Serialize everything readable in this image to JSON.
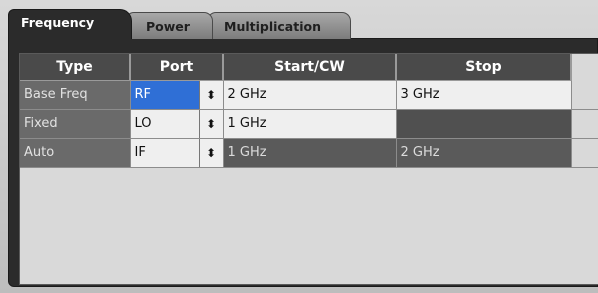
{
  "tabs": [
    {
      "label": "Frequency",
      "active": true
    },
    {
      "label": "Power",
      "active": false
    },
    {
      "label": "Multiplication",
      "active": false
    }
  ],
  "table": {
    "headers": [
      "Type",
      "Port",
      "Start/CW",
      "Stop"
    ],
    "rows": [
      {
        "type": "Base Freq",
        "port": "RF",
        "start": "2 GHz",
        "stop": "3 GHz",
        "selected": true
      },
      {
        "type": "Fixed",
        "port": "LO",
        "start": "1 GHz",
        "stop": ""
      },
      {
        "type": "Auto",
        "port": "IF",
        "start": "1 GHz",
        "stop": "2 GHz"
      }
    ],
    "spin_glyph": "⬍"
  },
  "colors": {
    "selection": "#2f6fd6",
    "tab_active_bg": "#2b2b2b",
    "header_bg": "#4a4a4a"
  }
}
